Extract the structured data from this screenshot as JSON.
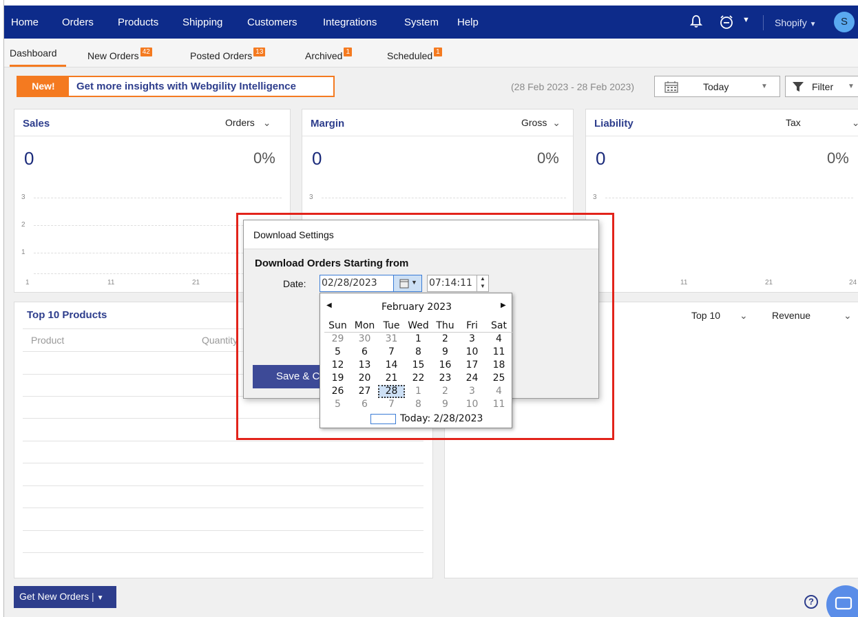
{
  "nav": {
    "items": [
      "Home",
      "Orders",
      "Products",
      "Shipping",
      "Customers",
      "Integrations",
      "System",
      "Help"
    ],
    "store": "Shopify",
    "avatar": "S"
  },
  "tabs": [
    {
      "label": "Dashboard",
      "badge": ""
    },
    {
      "label": "New Orders",
      "badge": "42"
    },
    {
      "label": "Posted Orders",
      "badge": "13"
    },
    {
      "label": "Archived",
      "badge": "1"
    },
    {
      "label": "Scheduled",
      "badge": "1"
    }
  ],
  "promo": {
    "new": "New!",
    "text": "Get more insights with Webgility Intelligence"
  },
  "date_range": "(28 Feb 2023 - 28 Feb 2023)",
  "period_select": "Today",
  "filter_label": "Filter",
  "cards": {
    "sales": {
      "title": "Sales",
      "select": "Orders",
      "value": "0",
      "pct": "0%"
    },
    "margin": {
      "title": "Margin",
      "select": "Gross",
      "value": "0",
      "pct": "0%"
    },
    "liability": {
      "title": "Liability",
      "select": "Tax",
      "value": "0",
      "pct": "0%"
    }
  },
  "axis": {
    "y": [
      "3",
      "2",
      "1"
    ],
    "x": [
      "1",
      "11",
      "21",
      "24"
    ]
  },
  "top_products": {
    "title": "Top 10 Products",
    "col_product": "Product",
    "col_quantity": "Quantity"
  },
  "right_panel": {
    "top_select": "Top 10",
    "metric_select": "Revenue"
  },
  "bottom": {
    "get_orders": "Get New Orders"
  },
  "dialog": {
    "title": "Download Settings",
    "subtitle": "Download Orders Starting from",
    "date_label": "Date:",
    "date_value": "02/28/2023",
    "time_value": "07:14:11",
    "save_button": "Save & C"
  },
  "calendar": {
    "month": "February 2023",
    "weekdays": [
      "Sun",
      "Mon",
      "Tue",
      "Wed",
      "Thu",
      "Fri",
      "Sat"
    ],
    "weeks": [
      [
        "29",
        "30",
        "31",
        "1",
        "2",
        "3",
        "4"
      ],
      [
        "5",
        "6",
        "7",
        "8",
        "9",
        "10",
        "11"
      ],
      [
        "12",
        "13",
        "14",
        "15",
        "16",
        "17",
        "18"
      ],
      [
        "19",
        "20",
        "21",
        "22",
        "23",
        "24",
        "25"
      ],
      [
        "26",
        "27",
        "28",
        "1",
        "2",
        "3",
        "4"
      ],
      [
        "5",
        "6",
        "7",
        "8",
        "9",
        "10",
        "11"
      ]
    ],
    "selected": "28",
    "today_text": "Today: 2/28/2023"
  },
  "colors": {
    "navbar": "#0d2b8a",
    "accent": "#f47a20",
    "title_blue": "#2d3d8c",
    "highlight_red": "#e2231a"
  },
  "icons": [
    "bell-icon",
    "alarm-icon",
    "calendar-icon",
    "filter-icon",
    "help-icon",
    "chat-icon"
  ]
}
